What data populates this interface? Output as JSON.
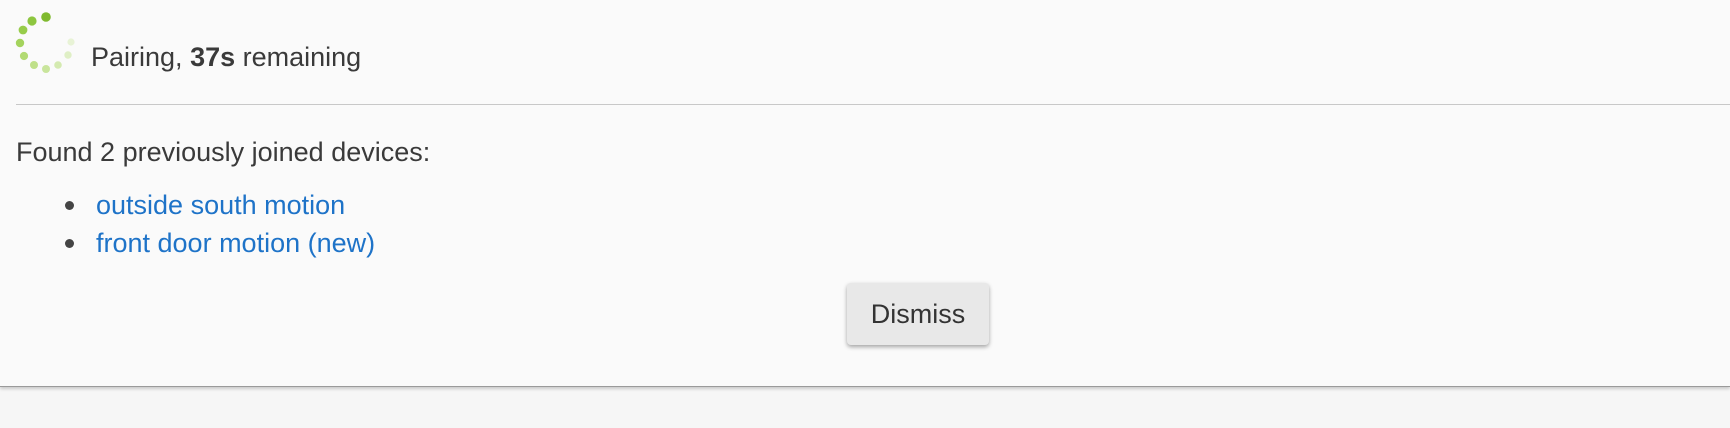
{
  "pairing": {
    "prefix": "Pairing, ",
    "time": "37s",
    "suffix": " remaining"
  },
  "found": {
    "text": "Found 2 previously joined devices:"
  },
  "devices": [
    {
      "label": "outside south motion"
    },
    {
      "label": "front door motion (new)"
    }
  ],
  "actions": {
    "dismiss_label": "Dismiss"
  },
  "colors": {
    "spinner": "#8dc63f",
    "link": "#1e73c8",
    "text": "#3a3a3a",
    "background": "#fafafa",
    "button": "#e8e8e8"
  },
  "icons": {
    "spinner": "loading-spinner-icon",
    "bullet": "bullet-icon"
  }
}
